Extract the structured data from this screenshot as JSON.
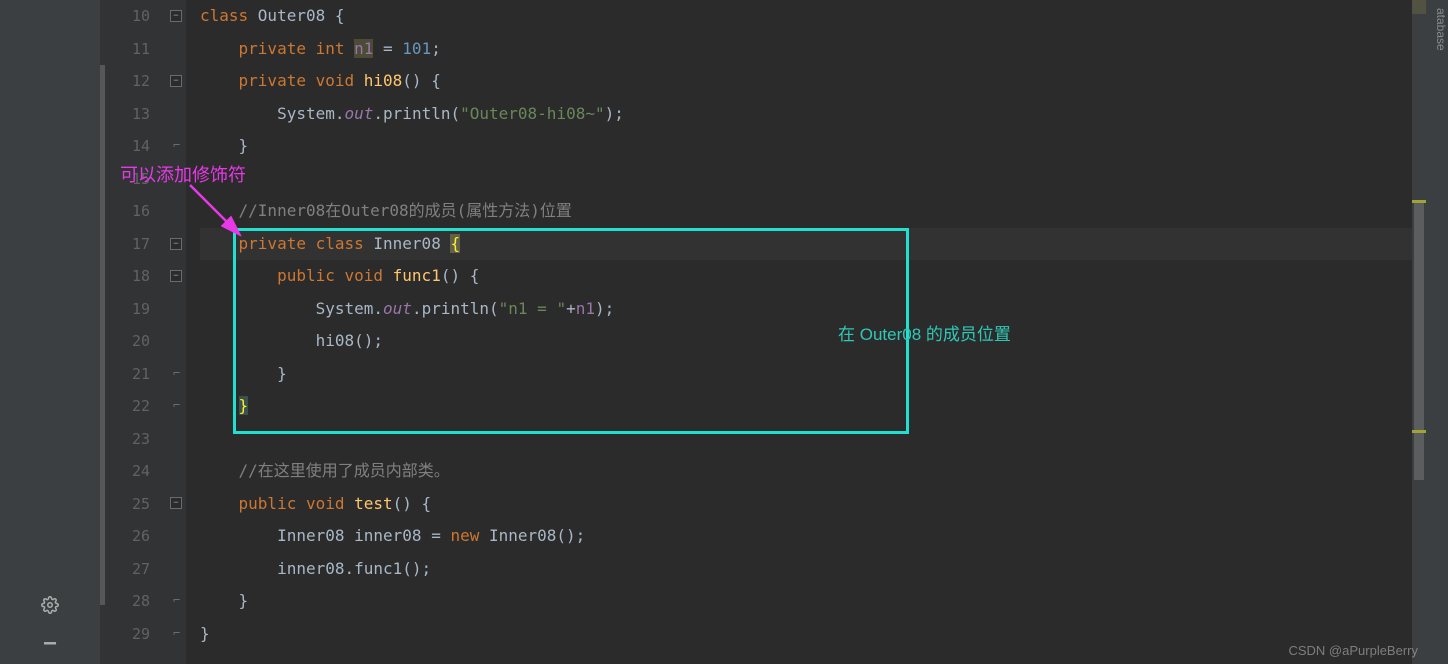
{
  "lineNumbers": [
    "10",
    "11",
    "12",
    "13",
    "14",
    "15",
    "16",
    "17",
    "18",
    "19",
    "20",
    "21",
    "22",
    "23",
    "24",
    "25",
    "26",
    "27",
    "28",
    "29"
  ],
  "code": {
    "l10": {
      "indent": "",
      "tokens": [
        {
          "t": "class ",
          "c": "kw"
        },
        {
          "t": "Outer08 {",
          "c": ""
        }
      ]
    },
    "l11": {
      "indent": "    ",
      "tokens": [
        {
          "t": "private int ",
          "c": "kw"
        },
        {
          "t": "n1",
          "c": "field hl-var"
        },
        {
          "t": " = ",
          "c": ""
        },
        {
          "t": "101",
          "c": "num"
        },
        {
          "t": ";",
          "c": ""
        }
      ]
    },
    "l12": {
      "indent": "    ",
      "tokens": [
        {
          "t": "private void ",
          "c": "kw"
        },
        {
          "t": "hi08",
          "c": "method-decl"
        },
        {
          "t": "() {",
          "c": ""
        }
      ]
    },
    "l13": {
      "indent": "        ",
      "tokens": [
        {
          "t": "System.",
          "c": ""
        },
        {
          "t": "out",
          "c": "static-field"
        },
        {
          "t": ".println(",
          "c": ""
        },
        {
          "t": "\"Outer08-hi08~\"",
          "c": "str"
        },
        {
          "t": ");",
          "c": ""
        }
      ]
    },
    "l14": {
      "indent": "    ",
      "tokens": [
        {
          "t": "}",
          "c": ""
        }
      ]
    },
    "l15": {
      "indent": "",
      "tokens": []
    },
    "l16": {
      "indent": "    ",
      "tokens": [
        {
          "t": "//Inner08在Outer08的成员(属性方法)位置",
          "c": "comment"
        }
      ]
    },
    "l17": {
      "indent": "    ",
      "tokens": [
        {
          "t": "private class ",
          "c": "kw"
        },
        {
          "t": "Inner08 ",
          "c": ""
        },
        {
          "t": "{",
          "c": "cursor-brace"
        }
      ]
    },
    "l18": {
      "indent": "        ",
      "tokens": [
        {
          "t": "public void ",
          "c": "kw"
        },
        {
          "t": "func1",
          "c": "method-decl"
        },
        {
          "t": "() {",
          "c": ""
        }
      ]
    },
    "l19": {
      "indent": "            ",
      "tokens": [
        {
          "t": "System.",
          "c": ""
        },
        {
          "t": "out",
          "c": "static-field"
        },
        {
          "t": ".println(",
          "c": ""
        },
        {
          "t": "\"n1 = \"",
          "c": "str"
        },
        {
          "t": "+",
          "c": ""
        },
        {
          "t": "n1",
          "c": "field"
        },
        {
          "t": ");",
          "c": ""
        }
      ]
    },
    "l20": {
      "indent": "            ",
      "tokens": [
        {
          "t": "hi08();",
          "c": ""
        }
      ]
    },
    "l21": {
      "indent": "        ",
      "tokens": [
        {
          "t": "}",
          "c": ""
        }
      ]
    },
    "l22": {
      "indent": "    ",
      "tokens": [
        {
          "t": "}",
          "c": "matched-brace"
        }
      ]
    },
    "l23": {
      "indent": "",
      "tokens": []
    },
    "l24": {
      "indent": "    ",
      "tokens": [
        {
          "t": "//在这里使用了成员内部类。",
          "c": "comment"
        }
      ]
    },
    "l25": {
      "indent": "    ",
      "tokens": [
        {
          "t": "public void ",
          "c": "kw"
        },
        {
          "t": "test",
          "c": "method-decl"
        },
        {
          "t": "() {",
          "c": ""
        }
      ]
    },
    "l26": {
      "indent": "        ",
      "tokens": [
        {
          "t": "Inner08 inner08 = ",
          "c": ""
        },
        {
          "t": "new ",
          "c": "kw"
        },
        {
          "t": "Inner08();",
          "c": ""
        }
      ]
    },
    "l27": {
      "indent": "        ",
      "tokens": [
        {
          "t": "inner08.func1();",
          "c": ""
        }
      ]
    },
    "l28": {
      "indent": "    ",
      "tokens": [
        {
          "t": "}",
          "c": ""
        }
      ]
    },
    "l29": {
      "indent": "",
      "tokens": [
        {
          "t": "}",
          "c": ""
        }
      ]
    }
  },
  "annotations": {
    "magenta": "可以添加修饰符",
    "teal": "在 Outer08 的成员位置"
  },
  "rightPanel": "atabase",
  "watermark": "CSDN @aPurpleBerry"
}
